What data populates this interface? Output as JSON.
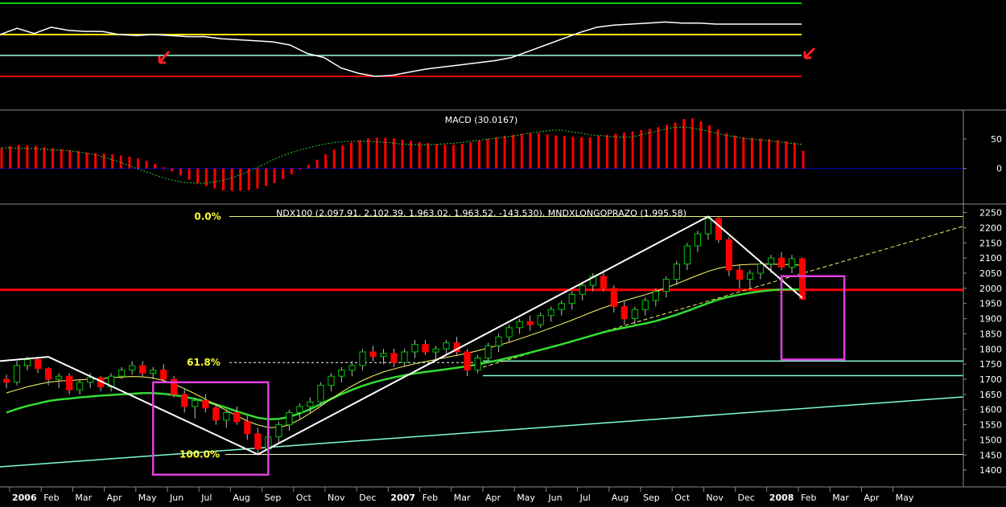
{
  "colors": {
    "background": "#000000",
    "up": "#00c800",
    "down": "#ff0000",
    "ma_long": "#33dd33",
    "ma_short": "#ffff66",
    "fib_label": "#ffff33",
    "trendline": "#ffffff",
    "box": "#e040e0",
    "support": "#80ffd0",
    "resistance": "#ff0000",
    "osc_green": "#00d000",
    "osc_yellow": "#ffee00",
    "osc_red": "#ff0000",
    "osc_white": "#ffffff",
    "osc_flat": "#a0ffe0",
    "macd_signal": "#33cc33",
    "zero_line": "#0000cc",
    "grid": "#8a8a8a",
    "text": "#ffffff"
  },
  "chart_data": [
    {
      "id": "oscillator",
      "type": "line",
      "title": "",
      "series": [
        {
          "color_key": "osc_green",
          "values": [
            100,
            100,
            100,
            100,
            100,
            100,
            100,
            100,
            100,
            100,
            100,
            100,
            100,
            100,
            100,
            100,
            100,
            100,
            100,
            100,
            100,
            100,
            100,
            100,
            100,
            100,
            100,
            100,
            100,
            100,
            100,
            100,
            100,
            100,
            100,
            100,
            100,
            100,
            100,
            100,
            100,
            100,
            100,
            100,
            100,
            100,
            100,
            100
          ]
        },
        {
          "color_key": "osc_yellow",
          "values": [
            70,
            70,
            70,
            70,
            70,
            70,
            70,
            70,
            70,
            70,
            70,
            70,
            70,
            70,
            70,
            70,
            70,
            70,
            70,
            70,
            70,
            70,
            70,
            70,
            70,
            70,
            70,
            70,
            70,
            70,
            70,
            70,
            70,
            70,
            70,
            70,
            70,
            70,
            70,
            70,
            70,
            70,
            70,
            70,
            70,
            70,
            70,
            70
          ]
        },
        {
          "color_key": "osc_red",
          "values": [
            30,
            30,
            30,
            30,
            30,
            30,
            30,
            30,
            30,
            30,
            30,
            30,
            30,
            30,
            30,
            30,
            30,
            30,
            30,
            30,
            30,
            30,
            30,
            30,
            30,
            30,
            30,
            30,
            30,
            30,
            30,
            30,
            30,
            30,
            30,
            30,
            30,
            30,
            30,
            30,
            30,
            30,
            30,
            30,
            30,
            30,
            30,
            30
          ]
        },
        {
          "color_key": "osc_white",
          "values": [
            70,
            76,
            71,
            77,
            74,
            73,
            73,
            70,
            69,
            70,
            69,
            68,
            68,
            66,
            65,
            64,
            63,
            60,
            52,
            48,
            38,
            33,
            30,
            31,
            34,
            37,
            39,
            41,
            43,
            45,
            48,
            54,
            60,
            66,
            72,
            77,
            79,
            80,
            81,
            82,
            81,
            81,
            80,
            80,
            80,
            80,
            80,
            80
          ]
        }
      ],
      "flat_level": 50,
      "ylim": [
        0,
        100
      ]
    },
    {
      "id": "macd",
      "type": "bar",
      "title": "MACD (30.0167)",
      "yticks": [
        50,
        0
      ],
      "ylim": [
        -55,
        95
      ],
      "histogram": [
        35,
        38,
        40,
        39,
        38,
        36,
        34,
        33,
        31,
        29,
        27,
        26,
        25,
        24,
        22,
        20,
        17,
        13,
        8,
        2,
        -5,
        -12,
        -19,
        -25,
        -30,
        -34,
        -37,
        -38,
        -38,
        -37,
        -34,
        -30,
        -25,
        -18,
        -10,
        -2,
        6,
        15,
        24,
        32,
        39,
        44,
        48,
        51,
        52,
        52,
        51,
        49,
        47,
        45,
        43,
        41,
        40,
        40,
        42,
        44,
        47,
        50,
        53,
        55,
        57,
        59,
        60,
        60,
        58,
        56,
        55,
        54,
        53,
        53,
        55,
        57,
        59,
        61,
        63,
        65,
        67,
        70,
        74,
        78,
        84,
        85,
        80,
        73,
        66,
        60,
        56,
        53,
        52,
        51,
        50,
        48,
        46,
        44,
        30
      ],
      "signal": [
        35,
        35,
        34,
        34,
        33,
        32,
        31,
        30,
        28,
        25,
        22,
        17,
        12,
        6,
        0,
        -6,
        -12,
        -17,
        -21,
        -24,
        -25,
        -25,
        -23,
        -20,
        -15,
        -9,
        -2,
        6,
        14,
        21,
        27,
        32,
        36,
        40,
        43,
        45,
        46,
        46,
        46,
        45,
        44,
        42,
        41,
        40,
        40,
        41,
        42,
        43,
        45,
        47,
        49,
        51,
        53,
        55,
        58,
        61,
        63,
        65,
        65,
        62,
        60,
        57,
        56,
        54,
        53,
        53,
        56,
        60,
        64,
        68,
        70,
        70,
        67,
        64,
        60,
        56,
        54,
        51,
        49,
        48,
        46,
        44,
        42,
        41
      ]
    },
    {
      "id": "price",
      "type": "candlestick",
      "title": "NDX100 (2,097.91, 2,102.39, 1,963.02, 1,963.52, -143.530), MNDXLONGOPRAZO (1,995.58)",
      "ylim": [
        1350,
        2270
      ],
      "yticks": [
        1400,
        1450,
        1500,
        1550,
        1600,
        1650,
        1700,
        1750,
        1800,
        1850,
        1900,
        1950,
        2000,
        2050,
        2100,
        2150,
        2200,
        2250
      ],
      "x_labels": [
        "2006",
        "Feb",
        "Mar",
        "Apr",
        "May",
        "Jun",
        "Jul",
        "Aug",
        "Sep",
        "Oct",
        "Nov",
        "Dec",
        "2007",
        "Feb",
        "Mar",
        "Apr",
        "May",
        "Jun",
        "Jul",
        "Aug",
        "Sep",
        "Oct",
        "Nov",
        "Dec",
        "2008",
        "Feb",
        "Mar",
        "Apr",
        "May"
      ],
      "fib_labels": [
        {
          "text": "0.0%",
          "value": 2237
        },
        {
          "text": "61.8%",
          "value": 1755
        },
        {
          "text": "100.0%",
          "value": 1452
        }
      ],
      "resistance_level": 1995,
      "support_levels": [
        1760,
        1712,
        1452
      ],
      "candles": [
        [
          1700,
          1715,
          1670,
          1690
        ],
        [
          1690,
          1760,
          1680,
          1745
        ],
        [
          1745,
          1775,
          1730,
          1765
        ],
        [
          1765,
          1770,
          1720,
          1735
        ],
        [
          1735,
          1740,
          1680,
          1700
        ],
        [
          1700,
          1720,
          1670,
          1710
        ],
        [
          1710,
          1720,
          1650,
          1665
        ],
        [
          1665,
          1700,
          1650,
          1690
        ],
        [
          1690,
          1720,
          1670,
          1705
        ],
        [
          1705,
          1710,
          1660,
          1675
        ],
        [
          1675,
          1720,
          1660,
          1710
        ],
        [
          1710,
          1740,
          1700,
          1730
        ],
        [
          1730,
          1760,
          1715,
          1745
        ],
        [
          1745,
          1760,
          1710,
          1720
        ],
        [
          1720,
          1740,
          1700,
          1730
        ],
        [
          1730,
          1750,
          1690,
          1700
        ],
        [
          1700,
          1710,
          1640,
          1650
        ],
        [
          1650,
          1670,
          1590,
          1610
        ],
        [
          1610,
          1640,
          1570,
          1630
        ],
        [
          1630,
          1650,
          1590,
          1605
        ],
        [
          1605,
          1620,
          1550,
          1565
        ],
        [
          1565,
          1600,
          1540,
          1590
        ],
        [
          1590,
          1610,
          1550,
          1560
        ],
        [
          1560,
          1580,
          1500,
          1520
        ],
        [
          1520,
          1540,
          1455,
          1470
        ],
        [
          1470,
          1520,
          1460,
          1510
        ],
        [
          1510,
          1560,
          1490,
          1550
        ],
        [
          1550,
          1600,
          1530,
          1590
        ],
        [
          1590,
          1620,
          1570,
          1610
        ],
        [
          1610,
          1640,
          1590,
          1625
        ],
        [
          1625,
          1690,
          1610,
          1680
        ],
        [
          1680,
          1720,
          1660,
          1710
        ],
        [
          1710,
          1740,
          1690,
          1730
        ],
        [
          1730,
          1760,
          1710,
          1745
        ],
        [
          1745,
          1800,
          1730,
          1790
        ],
        [
          1790,
          1810,
          1760,
          1775
        ],
        [
          1775,
          1800,
          1750,
          1785
        ],
        [
          1785,
          1800,
          1740,
          1755
        ],
        [
          1755,
          1800,
          1740,
          1790
        ],
        [
          1790,
          1830,
          1770,
          1815
        ],
        [
          1815,
          1830,
          1780,
          1790
        ],
        [
          1790,
          1810,
          1760,
          1800
        ],
        [
          1800,
          1830,
          1780,
          1820
        ],
        [
          1820,
          1840,
          1780,
          1790
        ],
        [
          1790,
          1800,
          1710,
          1730
        ],
        [
          1730,
          1780,
          1720,
          1770
        ],
        [
          1770,
          1820,
          1760,
          1810
        ],
        [
          1810,
          1850,
          1790,
          1840
        ],
        [
          1840,
          1880,
          1820,
          1870
        ],
        [
          1870,
          1900,
          1850,
          1890
        ],
        [
          1890,
          1910,
          1860,
          1880
        ],
        [
          1880,
          1920,
          1870,
          1910
        ],
        [
          1910,
          1940,
          1890,
          1930
        ],
        [
          1930,
          1960,
          1910,
          1950
        ],
        [
          1950,
          1990,
          1930,
          1980
        ],
        [
          1980,
          2020,
          1960,
          2010
        ],
        [
          2010,
          2050,
          1990,
          2040
        ],
        [
          2040,
          2060,
          1990,
          2000
        ],
        [
          2000,
          2010,
          1920,
          1940
        ],
        [
          1940,
          1960,
          1880,
          1900
        ],
        [
          1900,
          1940,
          1880,
          1930
        ],
        [
          1930,
          1970,
          1910,
          1960
        ],
        [
          1960,
          2000,
          1940,
          1990
        ],
        [
          1990,
          2040,
          1970,
          2030
        ],
        [
          2030,
          2090,
          2010,
          2080
        ],
        [
          2080,
          2150,
          2060,
          2140
        ],
        [
          2140,
          2190,
          2120,
          2180
        ],
        [
          2180,
          2237,
          2160,
          2230
        ],
        [
          2230,
          2235,
          2150,
          2160
        ],
        [
          2160,
          2170,
          2040,
          2060
        ],
        [
          2060,
          2080,
          2000,
          2030
        ],
        [
          2030,
          2060,
          2000,
          2050
        ],
        [
          2050,
          2090,
          2030,
          2080
        ],
        [
          2080,
          2110,
          2050,
          2100
        ],
        [
          2100,
          2120,
          2060,
          2070
        ],
        [
          2070,
          2110,
          2050,
          2098
        ],
        [
          2098,
          2102,
          1963,
          1964
        ]
      ],
      "ma_long": [
        1590,
        1602,
        1612,
        1620,
        1628,
        1633,
        1636,
        1640,
        1643,
        1646,
        1648,
        1650,
        1652,
        1654,
        1654,
        1652,
        1648,
        1642,
        1635,
        1627,
        1617,
        1606,
        1594,
        1583,
        1573,
        1568,
        1569,
        1576,
        1587,
        1601,
        1618,
        1635,
        1651,
        1665,
        1678,
        1689,
        1698,
        1706,
        1713,
        1719,
        1724,
        1728,
        1733,
        1738,
        1743,
        1749,
        1756,
        1763,
        1771,
        1779,
        1788,
        1797,
        1806,
        1815,
        1825,
        1835,
        1845,
        1855,
        1863,
        1870,
        1877,
        1884,
        1892,
        1902,
        1913,
        1925,
        1938,
        1951,
        1963,
        1972,
        1979,
        1985,
        1990,
        1994,
        1996,
        1996,
        1996
      ],
      "ma_short": [
        1655,
        1665,
        1675,
        1683,
        1690,
        1694,
        1696,
        1698,
        1700,
        1702,
        1705,
        1707,
        1709,
        1708,
        1704,
        1696,
        1684,
        1669,
        1652,
        1634,
        1615,
        1597,
        1579,
        1562,
        1549,
        1541,
        1541,
        1550,
        1567,
        1588,
        1611,
        1635,
        1657,
        1678,
        1696,
        1711,
        1724,
        1734,
        1743,
        1751,
        1758,
        1765,
        1772,
        1779,
        1786,
        1794,
        1803,
        1812,
        1822,
        1833,
        1845,
        1857,
        1869,
        1882,
        1895,
        1909,
        1923,
        1936,
        1948,
        1959,
        1969,
        1979,
        1990,
        2002,
        2015,
        2029,
        2043,
        2056,
        2066,
        2073,
        2077,
        2079,
        2080,
        2080,
        2079,
        2078,
        2076
      ]
    }
  ]
}
